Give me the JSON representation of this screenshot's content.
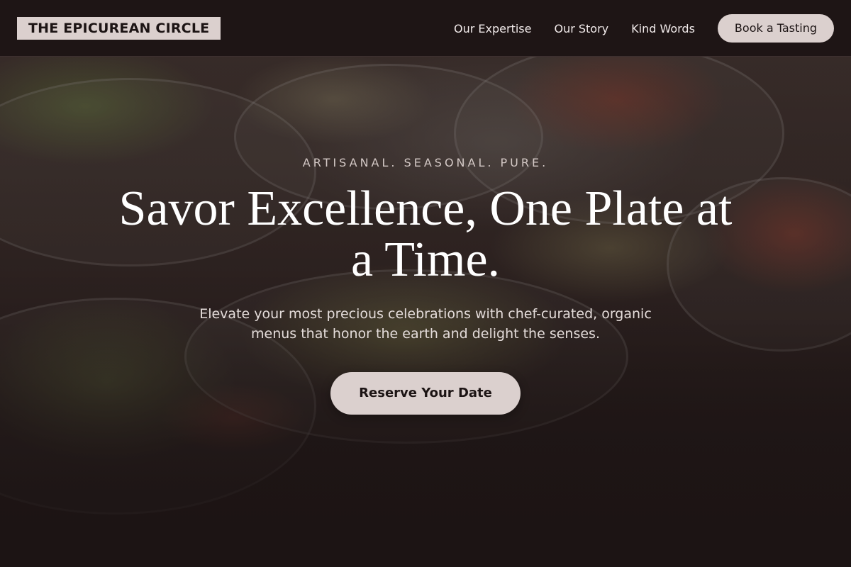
{
  "brand": {
    "name": "THE EPICUREAN CIRCLE"
  },
  "nav": {
    "links": [
      "Our Expertise",
      "Our Story",
      "Kind Words"
    ],
    "cta_label": "Book a Tasting"
  },
  "hero": {
    "eyebrow": "ARTISANAL. SEASONAL. PURE.",
    "headline": "Savor Excellence, One Plate at a Time.",
    "subtext": "Elevate your most precious celebrations with chef-curated, organic menus that honor the earth and delight the senses.",
    "cta_label": "Reserve Your Date",
    "background_image": "food-bowls-photo"
  },
  "colors": {
    "background": "#1c1414",
    "button": "#dbd0ce",
    "button_text": "#1c1414",
    "text": "#ffffff"
  }
}
